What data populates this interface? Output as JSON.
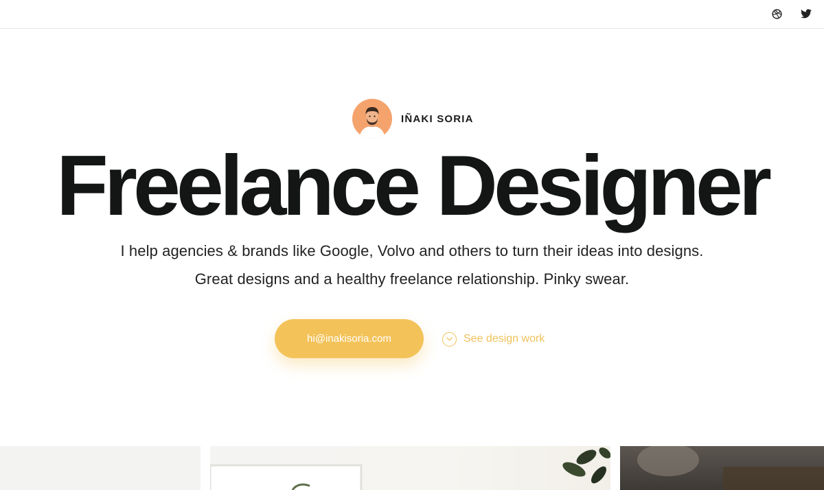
{
  "header": {
    "social": [
      {
        "icon": "dribbble-icon"
      },
      {
        "icon": "twitter-icon"
      }
    ]
  },
  "hero": {
    "name": "IÑAKI SORIA",
    "headline": "Freelance Designer",
    "tagline_line1": "I help agencies & brands like Google, Volvo and others to turn their ideas into designs.",
    "tagline_line2": "Great designs and a healthy freelance relationship. Pinky swear.",
    "email_button": "hi@inakisoria.com",
    "work_link": "See design work"
  },
  "colors": {
    "accent": "#f3c35a",
    "avatar_bg": "#f5a36d",
    "text": "#141616"
  }
}
